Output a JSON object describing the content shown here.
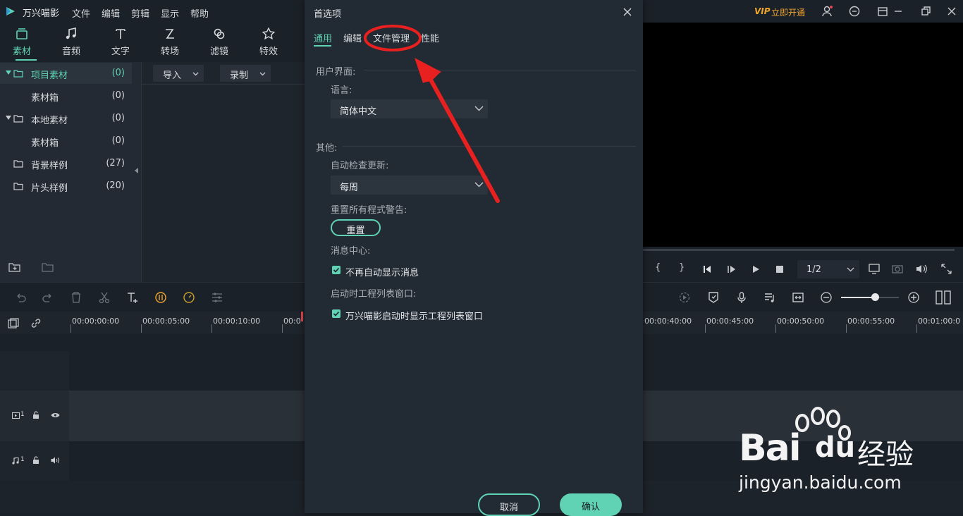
{
  "app": {
    "name": "万兴喵影",
    "menu": [
      "文件",
      "编辑",
      "剪辑",
      "显示",
      "帮助"
    ],
    "vip_badge": "VIP",
    "vip_label": "立即开通",
    "accent": "#5fd3b4"
  },
  "media_tabs": [
    "素材",
    "音频",
    "文字",
    "转场",
    "滤镜",
    "特效"
  ],
  "tree": [
    {
      "label": "项目素材",
      "count": "(0)"
    },
    {
      "label": "素材箱",
      "count": "(0)"
    },
    {
      "label": "本地素材",
      "count": "(0)"
    },
    {
      "label": "素材箱",
      "count": "(0)"
    },
    {
      "label": "背景样例",
      "count": "(27)"
    },
    {
      "label": "片头样例",
      "count": "(20)"
    }
  ],
  "media_toolbar": {
    "import": "导入",
    "record": "录制"
  },
  "ruler": [
    "00:00:00:00",
    "00:00:05:00",
    "00:00:10:00",
    "00:0",
    "00:00:40:00",
    "00:00:45:00",
    "00:00:50:00",
    "00:00:55:00",
    "00:01:00:0"
  ],
  "tracks": {
    "video": "1",
    "audio": "1"
  },
  "player": {
    "page": "1/2"
  },
  "dialog": {
    "title": "首选项",
    "tabs": [
      "通用",
      "编辑",
      "文件管理",
      "性能"
    ],
    "section_ui": "用户界面:",
    "language_label": "语言:",
    "language_value": "简体中文",
    "section_other": "其他:",
    "update_label": "自动检查更新:",
    "update_value": "每周",
    "reset_warn_label": "重置所有程式警告:",
    "reset_button": "重置",
    "msg_center_label": "消息中心:",
    "msg_checkbox": "不再自动显示消息",
    "startup_label": "启动时工程列表窗口:",
    "startup_checkbox": "万兴喵影启动时显示工程列表窗口",
    "cancel": "取消",
    "ok": "确认"
  },
  "watermark": {
    "brand": "Bai",
    "brand2": "du",
    "cn": "经验",
    "url": "jingyan.baidu.com"
  }
}
